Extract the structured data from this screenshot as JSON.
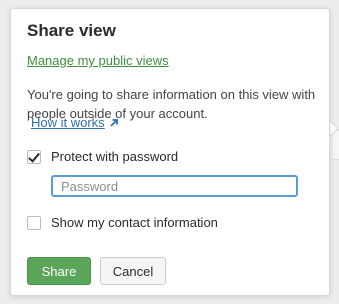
{
  "popover": {
    "title": "Share view",
    "manage_link": "Manage my public views",
    "description": "You're going to share information on this view with people outside of your account.",
    "how_link": "How it works",
    "how_link_icon": "external-link-arrow-icon"
  },
  "protect_password": {
    "label": "Protect with password",
    "checked": true
  },
  "password_field": {
    "value": "",
    "placeholder": "Password"
  },
  "contact_info": {
    "label": "Show my contact information",
    "checked": false
  },
  "actions": {
    "share_label": "Share",
    "cancel_label": "Cancel"
  },
  "colors": {
    "share_button": "#5aa55a",
    "manage_link": "#3f8f3f",
    "how_link": "#2e6fb0",
    "input_focus_border": "#5b9bd5"
  }
}
